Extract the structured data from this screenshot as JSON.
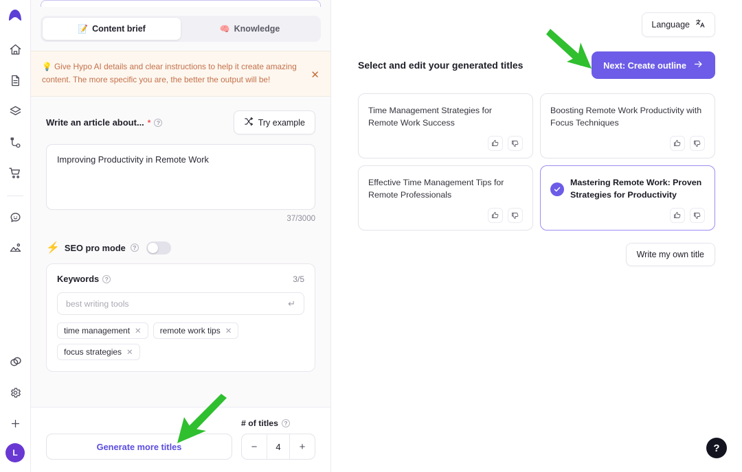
{
  "sidebar": {
    "logo_icon": "hypo-logo-icon",
    "items": [
      {
        "icon": "home-icon",
        "name": "home"
      },
      {
        "icon": "document-icon",
        "name": "documents"
      },
      {
        "icon": "layers-icon",
        "name": "layers"
      },
      {
        "icon": "workflow-icon",
        "name": "workflows"
      },
      {
        "icon": "cart-icon",
        "name": "store"
      },
      {
        "icon": "chat-smile-icon",
        "name": "chat"
      },
      {
        "icon": "image-icon",
        "name": "images"
      }
    ],
    "bottom_items": [
      {
        "icon": "rings-icon",
        "name": "integrations"
      },
      {
        "icon": "gear-icon",
        "name": "settings"
      },
      {
        "icon": "plus-icon",
        "name": "add"
      }
    ],
    "avatar_initial": "L"
  },
  "left_panel": {
    "tabs": [
      {
        "emoji": "📝",
        "label": "Content brief",
        "active": true
      },
      {
        "emoji": "🧠",
        "label": "Knowledge",
        "active": false
      }
    ],
    "banner": {
      "emoji": "💡",
      "text": "Give Hypo AI details and clear instructions to help it create amazing content. The more specific you are, the better the output will be!",
      "close_icon": "close-icon"
    },
    "article_field": {
      "label": "Write an article about...",
      "required_mark": "*",
      "help_icon": "?",
      "try_example_label": "Try example",
      "shuffle_icon": "shuffle-icon",
      "value": "Improving Productivity in Remote Work",
      "placeholder": "Improving Productivity in Remote Work",
      "char_count": "37/3000"
    },
    "seo": {
      "emoji": "⚡",
      "label": "SEO pro mode",
      "help_icon": "?",
      "toggle_on": false
    },
    "keywords": {
      "title": "Keywords",
      "help_icon": "?",
      "count": "3/5",
      "input_placeholder": "best writing tools",
      "input_value": "",
      "enter_icon": "enter-return-icon",
      "tags": [
        {
          "label": "time management"
        },
        {
          "label": "remote work tips"
        },
        {
          "label": "focus strategies"
        }
      ]
    },
    "footer": {
      "generate_label": "Generate more titles",
      "titles_label": "# of titles",
      "help_icon": "?",
      "minus_label": "−",
      "plus_label": "+",
      "count_value": "4"
    }
  },
  "right_panel": {
    "language_button": {
      "label": "Language",
      "icon": "translate-icon"
    },
    "heading": "Select and edit your generated titles",
    "next_button": {
      "label": "Next: Create outline",
      "icon": "arrow-right-icon"
    },
    "cards": [
      {
        "text": "Time Management Strategies for Remote Work Success",
        "selected": false,
        "like_icon": "thumbs-up-icon",
        "dislike_icon": "thumbs-down-icon"
      },
      {
        "text": "Boosting Remote Work Productivity with Focus Techniques",
        "selected": false,
        "like_icon": "thumbs-up-icon",
        "dislike_icon": "thumbs-down-icon"
      },
      {
        "text": "Effective Time Management Tips for Remote Professionals",
        "selected": false,
        "like_icon": "thumbs-up-icon",
        "dislike_icon": "thumbs-down-icon"
      },
      {
        "text": "Mastering Remote Work: Proven Strategies for Productivity",
        "selected": true,
        "like_icon": "thumbs-up-icon",
        "dislike_icon": "thumbs-down-icon"
      }
    ],
    "own_title_button": "Write my own title",
    "help_fab": "?"
  },
  "annotations": {
    "arrow_to_next_button": "green-arrow-pointing-to-next-create-outline",
    "arrow_to_generate_button": "green-arrow-pointing-to-generate-more-titles",
    "arrow_color": "#2fbf2f"
  },
  "colors": {
    "accent": "#6c5ce7",
    "accent_link": "#5b4ce0",
    "avatar": "#6938d3",
    "banner_text": "#c4704a",
    "banner_bg": "#fdf7ef",
    "annotation_green": "#2fbf2f"
  }
}
